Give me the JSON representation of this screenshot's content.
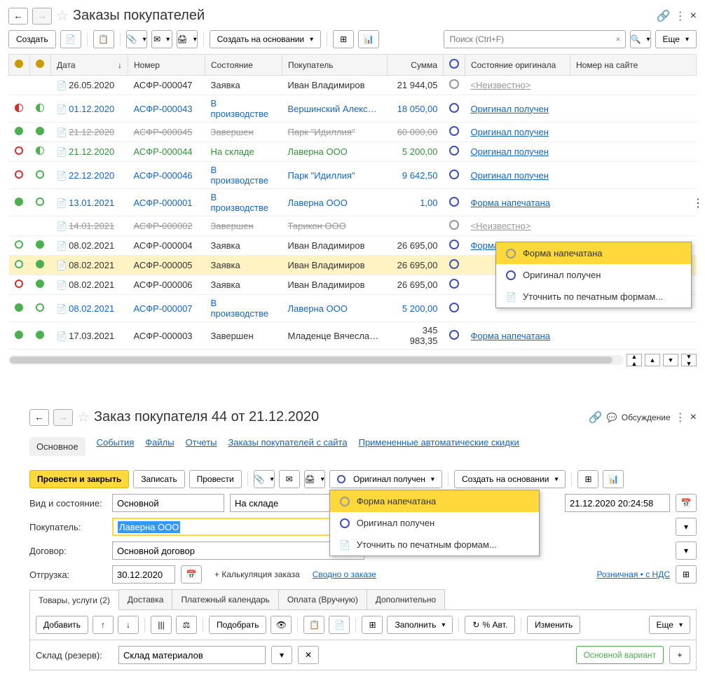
{
  "top": {
    "title": "Заказы покупателей",
    "create_btn": "Создать",
    "create_based_btn": "Создать на основании",
    "search_placeholder": "Поиск (Ctrl+F)",
    "more_btn": "Еще"
  },
  "cols": {
    "date": "Дата",
    "number": "Номер",
    "state": "Состояние",
    "buyer": "Покупатель",
    "sum": "Сумма",
    "orig_state": "Состояние оригинала",
    "site_num": "Номер на сайте"
  },
  "rows": [
    {
      "d1": "",
      "d2": "",
      "date": "26.05.2020",
      "num": "АСФР-000047",
      "state": "Заявка",
      "buyer": "Иван Владимиров",
      "sum": "21 944,05",
      "orig": "<Неизвестно>",
      "cls": "",
      "origcls": "gray",
      "datecls": ""
    },
    {
      "d1": "red-half",
      "d2": "green-half",
      "date": "01.12.2020",
      "num": "АСФР-000043",
      "state": "В производстве",
      "buyer": "Вершинский Алекс…",
      "sum": "18 050,00",
      "orig": "Оригинал получен",
      "cls": "",
      "origcls": "",
      "datecls": "txt-blue"
    },
    {
      "d1": "green-fill",
      "d2": "green-fill",
      "date": "21.12.2020",
      "num": "АСФР-000045",
      "state": "Завершен",
      "buyer": "Парк \"Идиллия\"",
      "sum": "60 000,00",
      "orig": "Оригинал получен",
      "cls": "",
      "origcls": "",
      "datecls": "txt-gray"
    },
    {
      "d1": "red-ring",
      "d2": "green-half",
      "date": "21.12.2020",
      "num": "АСФР-000044",
      "state": "На складе",
      "buyer": "Лаверна ООО",
      "sum": "5 200,00",
      "orig": "Оригинал получен",
      "cls": "",
      "origcls": "",
      "datecls": "txt-green"
    },
    {
      "d1": "red-ring",
      "d2": "green-ring",
      "date": "22.12.2020",
      "num": "АСФР-000046",
      "state": "В производстве",
      "buyer": "Парк \"Идиллия\"",
      "sum": "9 642,50",
      "orig": "Оригинал получен",
      "cls": "",
      "origcls": "",
      "datecls": "txt-blue"
    },
    {
      "d1": "green-fill",
      "d2": "green-ring",
      "date": "13.01.2021",
      "num": "АСФР-000001",
      "state": "В производстве",
      "buyer": "Лаверна ООО",
      "sum": "1,00",
      "orig": "Форма напечатана",
      "cls": "",
      "origcls": "",
      "datecls": "txt-blue"
    },
    {
      "d1": "",
      "d2": "",
      "date": "14.01.2021",
      "num": "АСФР-000002",
      "state": "Завершен",
      "buyer": "Тарикон ООО",
      "sum": "",
      "orig": "<Неизвестно>",
      "cls": "",
      "origcls": "gray",
      "datecls": "txt-gray"
    },
    {
      "d1": "green-ring",
      "d2": "green-fill",
      "date": "08.02.2021",
      "num": "АСФР-000004",
      "state": "Заявка",
      "buyer": "Иван Владимиров",
      "sum": "26 695,00",
      "orig": "Форма напечатана",
      "cls": "",
      "origcls": "",
      "datecls": ""
    },
    {
      "d1": "green-ring",
      "d2": "green-fill",
      "date": "08.02.2021",
      "num": "АСФР-000005",
      "state": "Заявка",
      "buyer": "Иван Владимиров",
      "sum": "26 695,00",
      "orig": "",
      "cls": "selected",
      "origcls": "",
      "datecls": ""
    },
    {
      "d1": "red-ring",
      "d2": "green-fill",
      "date": "08.02.2021",
      "num": "АСФР-000006",
      "state": "Заявка",
      "buyer": "Иван Владимиров",
      "sum": "26 695,00",
      "orig": "",
      "cls": "",
      "origcls": "",
      "datecls": ""
    },
    {
      "d1": "green-fill",
      "d2": "green-ring",
      "date": "08.02.2021",
      "num": "АСФР-000007",
      "state": "В производстве",
      "buyer": "Лаверна ООО",
      "sum": "5 200,00",
      "orig": "",
      "cls": "",
      "origcls": "",
      "datecls": "txt-blue"
    },
    {
      "d1": "green-fill",
      "d2": "green-fill",
      "date": "17.03.2021",
      "num": "АСФР-000003",
      "state": "Завершен",
      "buyer": "Младенце Вячесла…",
      "sum": "345 983,35",
      "orig": "Форма напечатана",
      "cls": "",
      "origcls": "",
      "datecls": ""
    }
  ],
  "ctx1": {
    "i1": "Форма напечатана",
    "i2": "Оригинал получен",
    "i3": "Уточнить по печатным формам..."
  },
  "sub": {
    "title": "Заказ покупателя 44 от 21.12.2020",
    "discuss": "Обсуждение",
    "tabs": {
      "main": "Основное",
      "events": "События",
      "files": "Файлы",
      "reports": "Отчеты",
      "orders": "Заказы покупателей с сайта",
      "disc": "Примененные автоматические скидки"
    },
    "post_close": "Провести и закрыть",
    "save": "Записать",
    "post": "Провести",
    "orig_recv": "Оригинал получен",
    "create_based": "Создать на основании",
    "kind_state": "Вид и состояние:",
    "kind_val": "Основной",
    "state_val": "На складе",
    "date_val": "21.12.2020 20:24:58",
    "buyer_lbl": "Покупатель:",
    "buyer_val": "Лаверна ООО",
    "contract_lbl": "Договор:",
    "contract_val": "Основной договор",
    "ship_lbl": "Отгрузка:",
    "ship_val": "30.12.2020",
    "calc": "+ Калькуляция заказа",
    "summary": "Сводно о заказе",
    "retail": "Розничная • с НДС",
    "subtabs": {
      "goods": "Товары, услуги (2)",
      "delivery": "Доставка",
      "pay_cal": "Платежный календарь",
      "pay_man": "Оплата (Вручную)",
      "extra": "Дополнительно"
    },
    "add": "Добавить",
    "pick": "Подобрать",
    "fill": "Заполнить",
    "auto": "% Авт.",
    "edit": "Изменить",
    "more": "Еще",
    "wh_lbl": "Склад (резерв):",
    "wh_val": "Склад материалов",
    "variant": "Основной вариант"
  },
  "ctx2": {
    "i1": "Форма напечатана",
    "i2": "Оригинал получен",
    "i3": "Уточнить по печатным формам..."
  }
}
